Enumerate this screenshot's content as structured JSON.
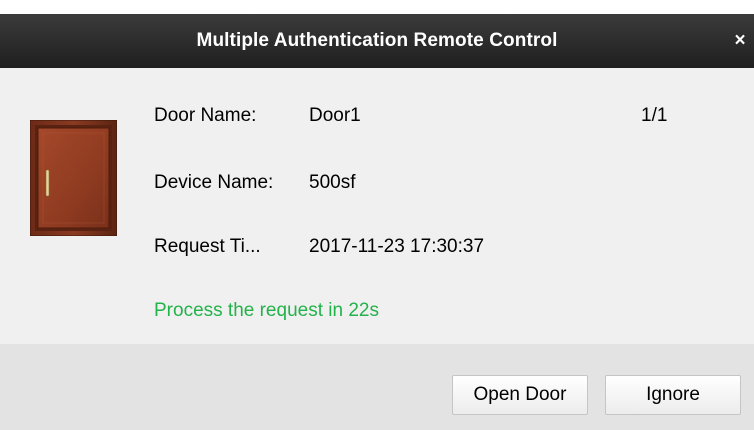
{
  "dialog": {
    "title": "Multiple Authentication Remote Control",
    "close_glyph": "×",
    "close_icon": "close-icon"
  },
  "door_icon": "door-icon",
  "colors": {
    "titlebar": "#2b2b2b",
    "body": "#f0f0f0",
    "footer": "#e3e3e3",
    "process_text": "#24b24a",
    "door": "#8a3a22"
  },
  "fields": {
    "door_name_label": "Door Name:",
    "door_name_value": "Door1",
    "counter": "1/1",
    "device_name_label": "Device Name:",
    "device_name_value": "500sf",
    "request_time_label": "Request Ti...",
    "request_time_value": "2017-11-23 17:30:37"
  },
  "status": {
    "process_text": "Process the request in 22s"
  },
  "buttons": {
    "open_door": "Open Door",
    "ignore": "Ignore"
  }
}
